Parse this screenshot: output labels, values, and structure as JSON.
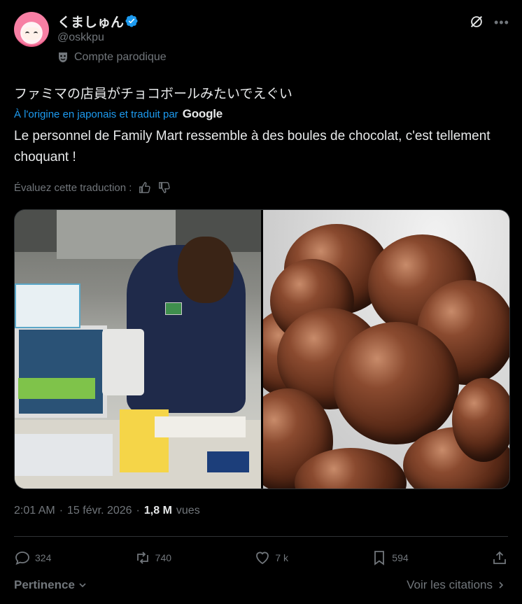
{
  "author": {
    "name": "くましゅん",
    "handle": "@oskkpu",
    "parody_label": "Compte parodique",
    "verified": true
  },
  "tweet": {
    "original_text": "ファミマの店員がチョコボールみたいでえぐい",
    "translated_by_label": "À l'origine en japonais et traduit par",
    "translator": "Google",
    "translation": "Le personnel de Family Mart ressemble à des boules de chocolat, c'est tellement choquant !",
    "rate_label": "Évaluez cette traduction :"
  },
  "media": {
    "left_photo_icon": "photo-store-clerk",
    "right_photo_icon": "photo-chocolate-balls"
  },
  "meta": {
    "time": "2:01 AM",
    "separator": "·",
    "date": "15 févr. 2026",
    "separator2": "·",
    "views_count": "1,8 M",
    "views_label": "vues"
  },
  "actions": {
    "replies": "324",
    "reposts": "740",
    "likes": "7 k",
    "bookmarks": "594"
  },
  "footer": {
    "sort_label": "Pertinence",
    "quotes_label": "Voir les citations"
  },
  "colors": {
    "background": "#000000",
    "accent": "#1d9bf0",
    "muted": "#71767b",
    "text": "#e7e9ea"
  }
}
